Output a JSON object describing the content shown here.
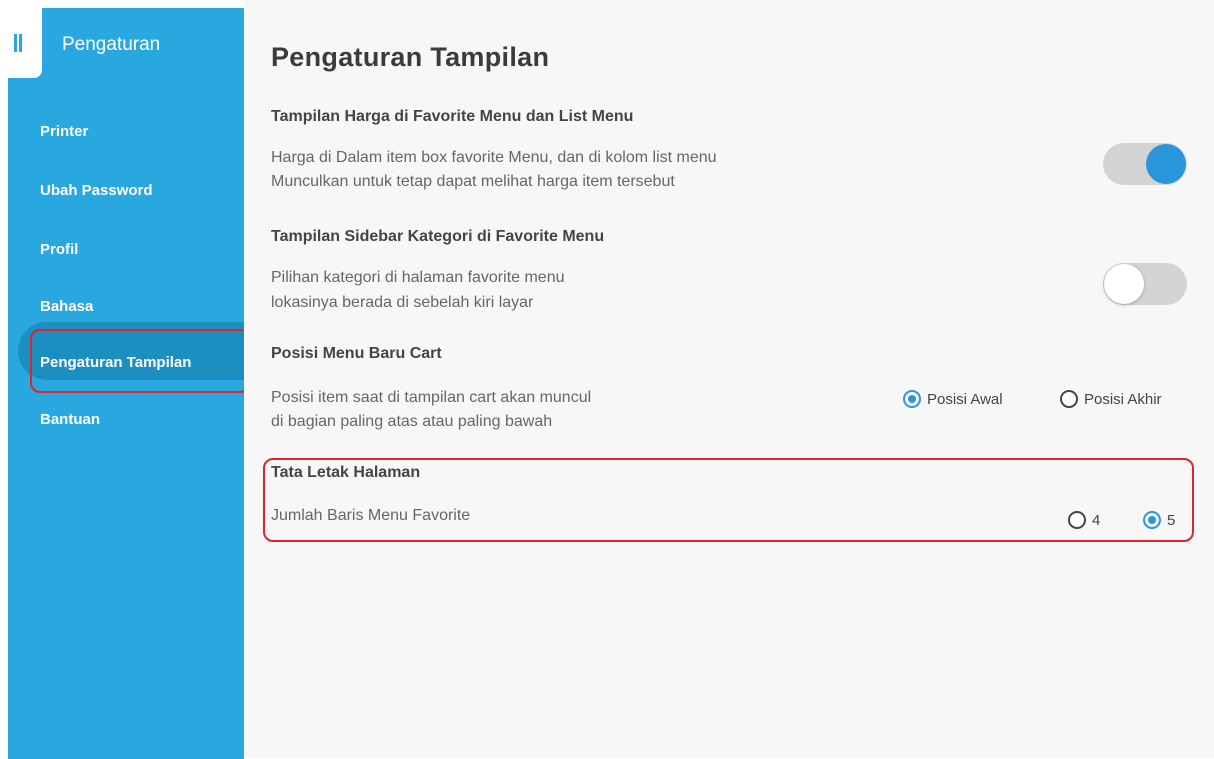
{
  "sidebar": {
    "title": "Pengaturan",
    "items": [
      {
        "label": "Printer"
      },
      {
        "label": "Ubah Password"
      },
      {
        "label": "Profil"
      },
      {
        "label": "Bahasa"
      },
      {
        "label": "Pengaturan Tampilan"
      },
      {
        "label": "Bantuan"
      }
    ],
    "active_item": "Pengaturan Tampilan"
  },
  "page": {
    "title": "Pengaturan Tampilan"
  },
  "sections": {
    "harga": {
      "title": "Tampilan Harga di Favorite Menu dan List Menu",
      "line1": "Harga di Dalam item box favorite Menu, dan di kolom list menu",
      "line2": "Munculkan untuk tetap dapat melihat harga item tersebut",
      "toggle_on": true
    },
    "sidebar_kategori": {
      "title": "Tampilan Sidebar Kategori di Favorite Menu",
      "line1": "Pilihan kategori di halaman favorite menu",
      "line2": "lokasinya berada di sebelah kiri layar",
      "toggle_on": false
    },
    "posisi_menu": {
      "title": "Posisi Menu Baru Cart",
      "line1": "Posisi item saat di tampilan cart akan muncul",
      "line2": "di bagian paling atas atau paling bawah",
      "options": [
        "Posisi Awal",
        "Posisi Akhir"
      ],
      "selected": "Posisi Awal"
    },
    "tata_letak": {
      "title": "Tata Letak Halaman",
      "line1": "Jumlah Baris Menu Favorite",
      "options": [
        "4",
        "5"
      ],
      "selected": "5"
    }
  },
  "colors": {
    "sidebar": "#29a8e0",
    "accent": "#2b95dc",
    "highlight": "#e0222b"
  }
}
